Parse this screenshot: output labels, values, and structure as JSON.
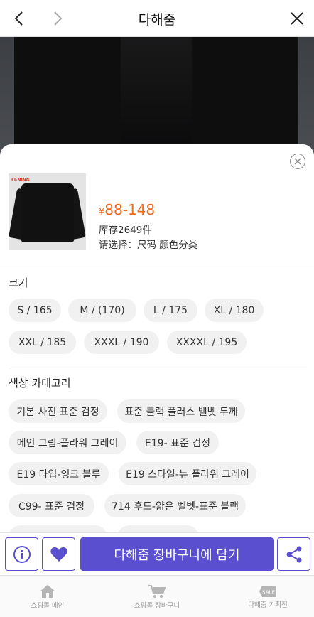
{
  "header": {
    "title": "다해줌"
  },
  "product": {
    "thumb_logo": "LI-NING",
    "currency": "¥",
    "price_range": "88-148",
    "stock": "库存2649件",
    "select_hint": "请选择：尺码 颜色分类"
  },
  "size": {
    "title": "크기",
    "options": [
      "S / 165",
      "M / (170)",
      "L / 175",
      "XL / 180",
      "XXL / 185",
      "XXXL / 190",
      "XXXXL / 195"
    ]
  },
  "color": {
    "title": "색상 카테고리",
    "options": [
      "기본 사진 표준 검정",
      "표준 블랙 플러스 벨벳 두께",
      "메인 그림-플라워 그레이",
      "E19- 표준 검정",
      "E19 타입-잉크 블루",
      "E19 스타일-뉴 플라워 그레이",
      "C99- 표준 검정",
      "714 후드-얇은 벨벳-표준 블랙"
    ]
  },
  "actions": {
    "add_to_cart": "다해줌 장바구니에 담기"
  },
  "tabs": [
    {
      "label": "쇼핑몰 메인",
      "icon": "home-icon"
    },
    {
      "label": "쇼핑몰 장바구니",
      "icon": "cart-icon"
    },
    {
      "label": "다해줌 기획전",
      "icon": "sale-tag-icon",
      "badge": "SALE"
    }
  ],
  "colors": {
    "accent": "#5a4fcf",
    "price": "#ef6a1f",
    "chip_bg": "#f1f1f1"
  }
}
